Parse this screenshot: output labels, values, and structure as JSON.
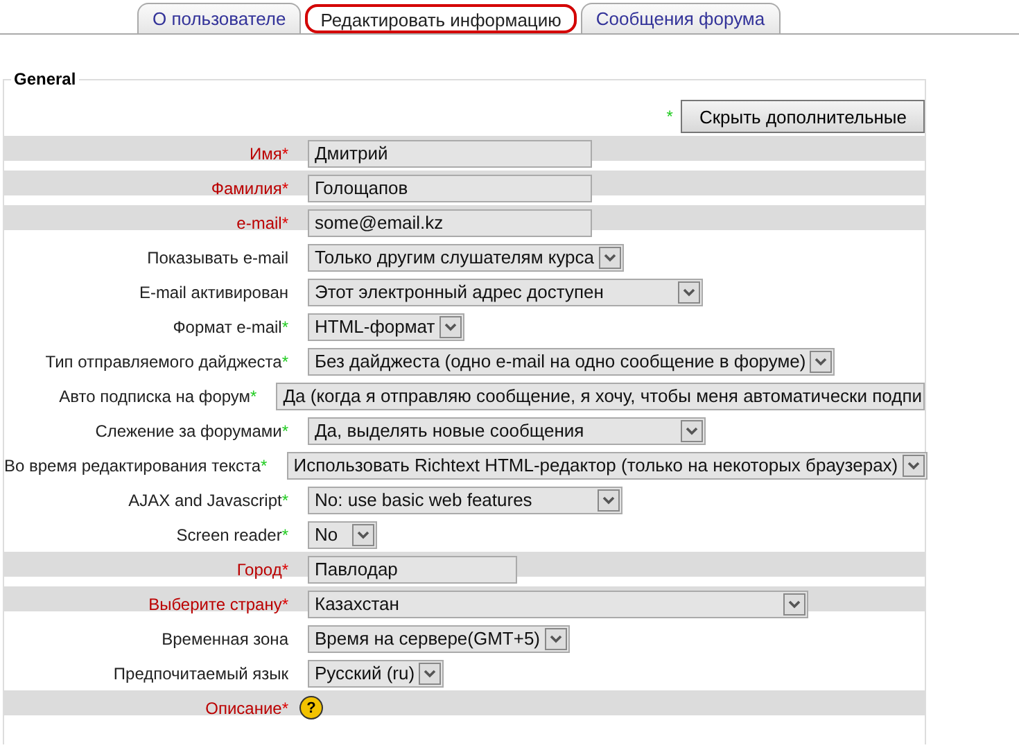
{
  "tabs": [
    {
      "label": "О пользователе",
      "selected": false
    },
    {
      "label": "Редактировать информацию",
      "selected": true
    },
    {
      "label": "Сообщения форума",
      "selected": false
    }
  ],
  "form": {
    "legend": "General",
    "advanced_star": "*",
    "advanced_button": "Скрыть дополнительные",
    "rows": [
      {
        "label": "Имя",
        "star": "*",
        "required": true,
        "kind": "text",
        "value": "Дмитрий"
      },
      {
        "label": "Фамилия",
        "star": "*",
        "required": true,
        "kind": "text",
        "value": "Голощапов"
      },
      {
        "label": "e-mail",
        "star": "*",
        "required": true,
        "kind": "text",
        "value": "some@email.kz"
      },
      {
        "label": "Показывать e-mail",
        "required": false,
        "kind": "select",
        "value": "Только другим слушателям курса"
      },
      {
        "label": "E-mail активирован",
        "required": false,
        "kind": "select",
        "value": "Этот электронный адрес доступен"
      },
      {
        "label": "Формат e-mail",
        "star": "*",
        "required": false,
        "kind": "select",
        "value": "HTML-формат"
      },
      {
        "label": "Тип отправляемого дайджеста",
        "star": "*",
        "required": false,
        "kind": "select",
        "value": "Без дайджеста (одно e-mail на одно сообщение в форуме)"
      },
      {
        "label": "Авто подписка на форум",
        "star": "*",
        "required": false,
        "kind": "select_cut",
        "value": "Да (когда я отправляю сообщение, я хочу, чтобы меня автоматически подпи"
      },
      {
        "label": "Слежение за форумами",
        "star": "*",
        "required": false,
        "kind": "select",
        "value": "Да, выделять новые сообщения"
      },
      {
        "label": "Во время редактирования текста",
        "star": "*",
        "required": false,
        "kind": "select",
        "value": "Использовать Richtext HTML-редактор (только на некоторых браузерах)"
      },
      {
        "label": "AJAX and Javascript",
        "star": "*",
        "required": false,
        "kind": "select",
        "value": "No: use basic web features"
      },
      {
        "label": "Screen reader",
        "star": "*",
        "required": false,
        "kind": "select",
        "value": "No"
      },
      {
        "label": "Город",
        "star": "*",
        "required": true,
        "kind": "text",
        "value": "Павлодар"
      },
      {
        "label": "Выберите страну",
        "star": "*",
        "required": true,
        "kind": "select",
        "value": "Казахстан"
      },
      {
        "label": "Временная зона",
        "required": false,
        "kind": "select",
        "value": "Время на сервере(GMT+5)"
      },
      {
        "label": "Предпочитаемый язык",
        "required": false,
        "kind": "select",
        "value": "Русский (ru)"
      },
      {
        "label": "Описание",
        "star": "*",
        "required": true,
        "kind": "help",
        "help": "?"
      }
    ]
  }
}
